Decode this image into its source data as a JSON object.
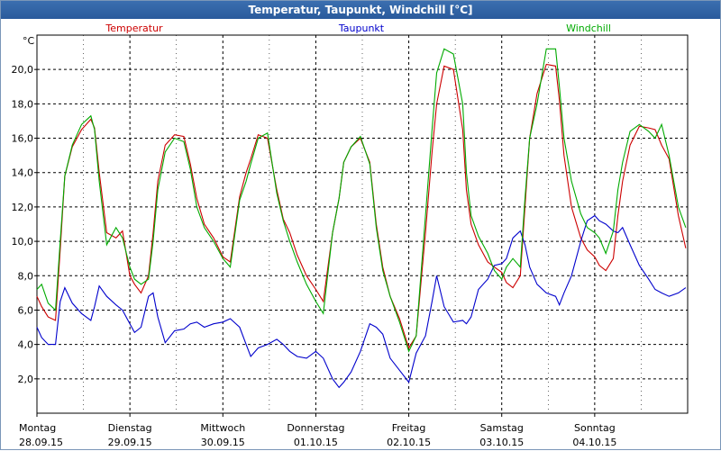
{
  "window": {
    "title": "Temperatur, Taupunkt, Windchill [°C]"
  },
  "chart_data": {
    "type": "line",
    "title": "Temperatur, Taupunkt, Windchill [°C]",
    "unit_label": "°C",
    "grid": true,
    "legend_placement": "top",
    "xlim": [
      0,
      7
    ],
    "ylim": [
      0,
      22
    ],
    "y_ticks": [
      2,
      4,
      6,
      8,
      10,
      12,
      14,
      16,
      18,
      20
    ],
    "y_tick_labels": [
      "2,0",
      "4,0",
      "6,0",
      "8,0",
      "10,0",
      "12,0",
      "14,0",
      "16,0",
      "18,0",
      "20,0"
    ],
    "x_ticks": [
      {
        "x": 0,
        "day": "Montag",
        "date": "28.09.15"
      },
      {
        "x": 1,
        "day": "Dienstag",
        "date": "29.09.15"
      },
      {
        "x": 2,
        "day": "Mittwoch",
        "date": "30.09.15"
      },
      {
        "x": 3,
        "day": "Donnerstag",
        "date": "01.10.15"
      },
      {
        "x": 4,
        "day": "Freitag",
        "date": "02.10.15"
      },
      {
        "x": 5,
        "day": "Samstag",
        "date": "03.10.15"
      },
      {
        "x": 6,
        "day": "Sonntag",
        "date": "04.10.15"
      }
    ],
    "series": [
      {
        "name": "Temperatur",
        "color": "#cc0000",
        "x": [
          0,
          0.05,
          0.12,
          0.2,
          0.25,
          0.3,
          0.38,
          0.48,
          0.58,
          0.62,
          0.67,
          0.75,
          0.85,
          0.92,
          1.0,
          1.05,
          1.12,
          1.2,
          1.25,
          1.3,
          1.38,
          1.48,
          1.58,
          1.65,
          1.72,
          1.8,
          1.9,
          2.0,
          2.08,
          2.18,
          2.25,
          2.3,
          2.38,
          2.48,
          2.58,
          2.65,
          2.72,
          2.8,
          2.9,
          3.0,
          3.08,
          3.18,
          3.25,
          3.3,
          3.38,
          3.48,
          3.58,
          3.65,
          3.72,
          3.8,
          3.9,
          4.0,
          4.08,
          4.18,
          4.25,
          4.3,
          4.38,
          4.48,
          4.58,
          4.62,
          4.67,
          4.75,
          4.85,
          4.92,
          5.0,
          5.05,
          5.12,
          5.2,
          5.25,
          5.3,
          5.38,
          5.48,
          5.58,
          5.62,
          5.67,
          5.75,
          5.85,
          5.92,
          6.0,
          6.05,
          6.12,
          6.2,
          6.25,
          6.3,
          6.38,
          6.48,
          6.58,
          6.65,
          6.72,
          6.8,
          6.9,
          6.98
        ],
        "y": [
          6.8,
          6.2,
          5.6,
          5.4,
          9.5,
          13.8,
          15.5,
          16.5,
          17.1,
          16.6,
          14.0,
          10.5,
          10.2,
          10.6,
          8.0,
          7.5,
          7.0,
          8.0,
          10.5,
          13.5,
          15.6,
          16.2,
          16.1,
          14.5,
          12.5,
          11.0,
          10.2,
          9.1,
          8.8,
          12.6,
          14.0,
          14.8,
          16.2,
          16.0,
          13.0,
          11.3,
          10.5,
          9.2,
          8.0,
          7.2,
          6.5,
          10.5,
          12.5,
          14.6,
          15.5,
          16.0,
          14.6,
          11.0,
          8.5,
          6.8,
          5.5,
          3.8,
          4.5,
          10.5,
          15.2,
          18.0,
          20.2,
          20.0,
          16.5,
          13.0,
          11.0,
          9.8,
          8.8,
          8.5,
          8.2,
          7.6,
          7.3,
          8.0,
          12.0,
          16.0,
          18.6,
          20.3,
          20.2,
          18.2,
          15.0,
          12.0,
          10.2,
          9.5,
          9.1,
          8.6,
          8.3,
          9.0,
          11.5,
          13.5,
          15.6,
          16.7,
          16.6,
          16.5,
          15.6,
          14.8,
          11.5,
          9.6
        ]
      },
      {
        "name": "Taupunkt",
        "color": "#0000cc",
        "x": [
          0,
          0.05,
          0.12,
          0.2,
          0.25,
          0.3,
          0.38,
          0.48,
          0.58,
          0.62,
          0.67,
          0.75,
          0.85,
          0.92,
          1.0,
          1.05,
          1.12,
          1.2,
          1.25,
          1.3,
          1.38,
          1.48,
          1.58,
          1.65,
          1.72,
          1.8,
          1.9,
          2.0,
          2.08,
          2.18,
          2.25,
          2.3,
          2.38,
          2.48,
          2.58,
          2.65,
          2.72,
          2.8,
          2.9,
          3.0,
          3.08,
          3.18,
          3.25,
          3.3,
          3.38,
          3.48,
          3.58,
          3.65,
          3.72,
          3.8,
          3.9,
          4.0,
          4.08,
          4.18,
          4.25,
          4.3,
          4.38,
          4.48,
          4.58,
          4.62,
          4.67,
          4.75,
          4.85,
          4.92,
          5.0,
          5.05,
          5.12,
          5.2,
          5.25,
          5.3,
          5.38,
          5.48,
          5.58,
          5.62,
          5.67,
          5.75,
          5.85,
          5.92,
          6.0,
          6.05,
          6.12,
          6.2,
          6.25,
          6.3,
          6.38,
          6.48,
          6.58,
          6.65,
          6.72,
          6.8,
          6.9,
          6.98
        ],
        "y": [
          5.0,
          4.4,
          4.0,
          4.0,
          6.5,
          7.3,
          6.4,
          5.8,
          5.4,
          6.2,
          7.4,
          6.8,
          6.3,
          6.0,
          5.2,
          4.7,
          5.0,
          6.8,
          7.0,
          5.6,
          4.1,
          4.8,
          4.9,
          5.2,
          5.3,
          5.0,
          5.2,
          5.3,
          5.5,
          5.0,
          4.0,
          3.3,
          3.8,
          4.0,
          4.3,
          4.0,
          3.6,
          3.3,
          3.2,
          3.6,
          3.2,
          2.0,
          1.5,
          1.8,
          2.4,
          3.6,
          5.2,
          5.0,
          4.6,
          3.2,
          2.5,
          1.8,
          3.5,
          4.5,
          6.5,
          8.0,
          6.2,
          5.3,
          5.4,
          5.2,
          5.6,
          7.2,
          7.8,
          8.6,
          8.7,
          9.0,
          10.2,
          10.6,
          9.8,
          8.5,
          7.5,
          7.0,
          6.8,
          6.3,
          7.0,
          8.0,
          10.0,
          11.2,
          11.5,
          11.2,
          11.0,
          10.6,
          10.5,
          10.8,
          9.8,
          8.6,
          7.8,
          7.2,
          7.0,
          6.8,
          7.0,
          7.3
        ]
      },
      {
        "name": "Windchill",
        "color": "#00aa00",
        "x": [
          0,
          0.05,
          0.12,
          0.2,
          0.25,
          0.3,
          0.38,
          0.48,
          0.58,
          0.62,
          0.67,
          0.75,
          0.85,
          0.92,
          1.0,
          1.05,
          1.12,
          1.2,
          1.25,
          1.3,
          1.38,
          1.48,
          1.58,
          1.65,
          1.72,
          1.8,
          1.9,
          2.0,
          2.08,
          2.18,
          2.25,
          2.3,
          2.38,
          2.48,
          2.58,
          2.65,
          2.72,
          2.8,
          2.9,
          3.0,
          3.08,
          3.18,
          3.25,
          3.3,
          3.38,
          3.48,
          3.58,
          3.65,
          3.72,
          3.8,
          3.9,
          4.0,
          4.08,
          4.18,
          4.25,
          4.3,
          4.38,
          4.48,
          4.58,
          4.62,
          4.67,
          4.75,
          4.85,
          4.92,
          5.0,
          5.05,
          5.12,
          5.2,
          5.25,
          5.3,
          5.38,
          5.48,
          5.58,
          5.62,
          5.67,
          5.75,
          5.85,
          5.92,
          6.0,
          6.05,
          6.12,
          6.2,
          6.25,
          6.3,
          6.38,
          6.48,
          6.58,
          6.65,
          6.72,
          6.8,
          6.9,
          6.98
        ],
        "y": [
          7.2,
          7.5,
          6.4,
          6.0,
          10.0,
          13.8,
          15.6,
          16.8,
          17.3,
          16.5,
          13.5,
          9.8,
          10.8,
          10.2,
          8.5,
          7.8,
          7.5,
          7.8,
          10.0,
          13.0,
          15.2,
          16.0,
          15.8,
          14.2,
          12.0,
          10.8,
          10.0,
          9.0,
          8.5,
          12.4,
          13.5,
          14.5,
          16.0,
          16.3,
          12.8,
          11.2,
          10.0,
          8.8,
          7.5,
          6.5,
          5.8,
          10.5,
          12.5,
          14.6,
          15.5,
          16.1,
          14.5,
          10.8,
          8.3,
          6.8,
          5.3,
          3.6,
          4.5,
          11.5,
          16.5,
          19.8,
          21.2,
          20.9,
          18.0,
          14.0,
          11.5,
          10.3,
          9.3,
          8.3,
          7.8,
          8.5,
          9.0,
          8.5,
          12.5,
          16.0,
          18.0,
          21.2,
          21.2,
          19.0,
          16.0,
          13.5,
          11.6,
          10.8,
          10.5,
          10.2,
          9.3,
          10.6,
          13.0,
          14.6,
          16.4,
          16.8,
          16.4,
          16.0,
          16.8,
          15.0,
          12.0,
          10.8
        ]
      }
    ]
  }
}
